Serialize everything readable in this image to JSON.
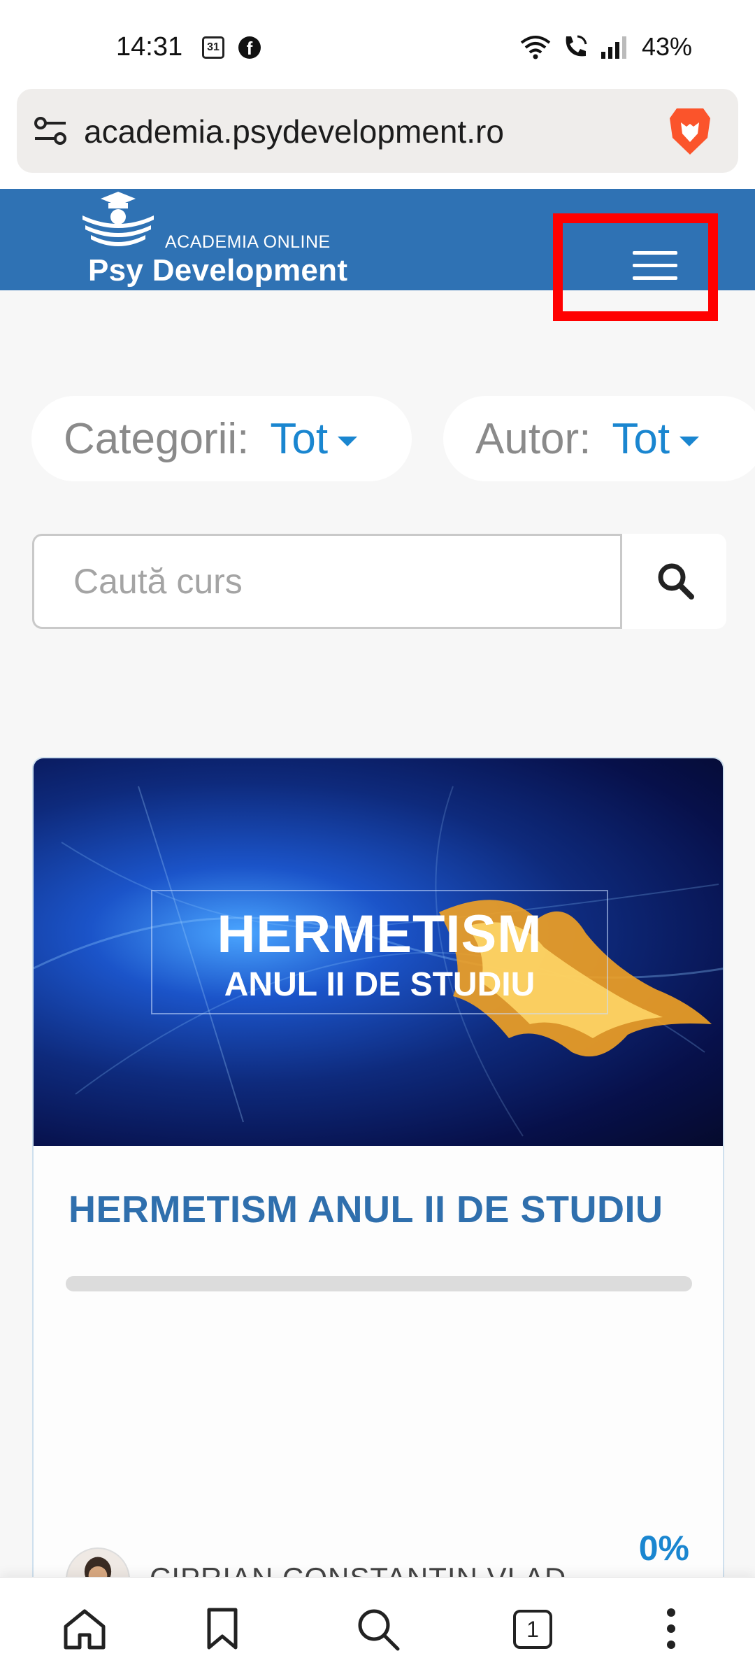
{
  "status_bar": {
    "time": "14:31",
    "calendar_day": "31",
    "facebook_glyph": "f",
    "battery": "43%",
    "icons": [
      "calendar-icon",
      "facebook-icon",
      "wifi-icon",
      "call-icon",
      "signal-icon"
    ]
  },
  "browser": {
    "url": "academia.psydevelopment.ro",
    "icons": [
      "tune-icon",
      "brave-lion-icon"
    ]
  },
  "header": {
    "logo_small": "ACADEMIA ONLINE",
    "logo_big": "Psy Development",
    "menu_icon": "hamburger-menu-icon",
    "highlight_color": "#ff0000",
    "brand_color": "#2f72b4"
  },
  "filters": {
    "category_label": "Categorii:",
    "category_value": "Tot",
    "author_label": "Autor:",
    "author_value": "Tot",
    "accent_color": "#1a86d0"
  },
  "search": {
    "placeholder": "Caută curs",
    "button_icon": "search-icon"
  },
  "course": {
    "image_title_line1": "HERMETISM",
    "image_title_line2": "ANUL II DE STUDIU",
    "title": "HERMETISM ANUL II DE STUDIU",
    "progress": 0,
    "percent_text": "0%",
    "author": "CIPRIAN CONSTANTIN VLAD"
  },
  "bottom_nav": {
    "tab_count": "1",
    "icons": [
      "home-icon",
      "bookmark-icon",
      "search-icon",
      "tabs-icon",
      "more-icon"
    ]
  }
}
